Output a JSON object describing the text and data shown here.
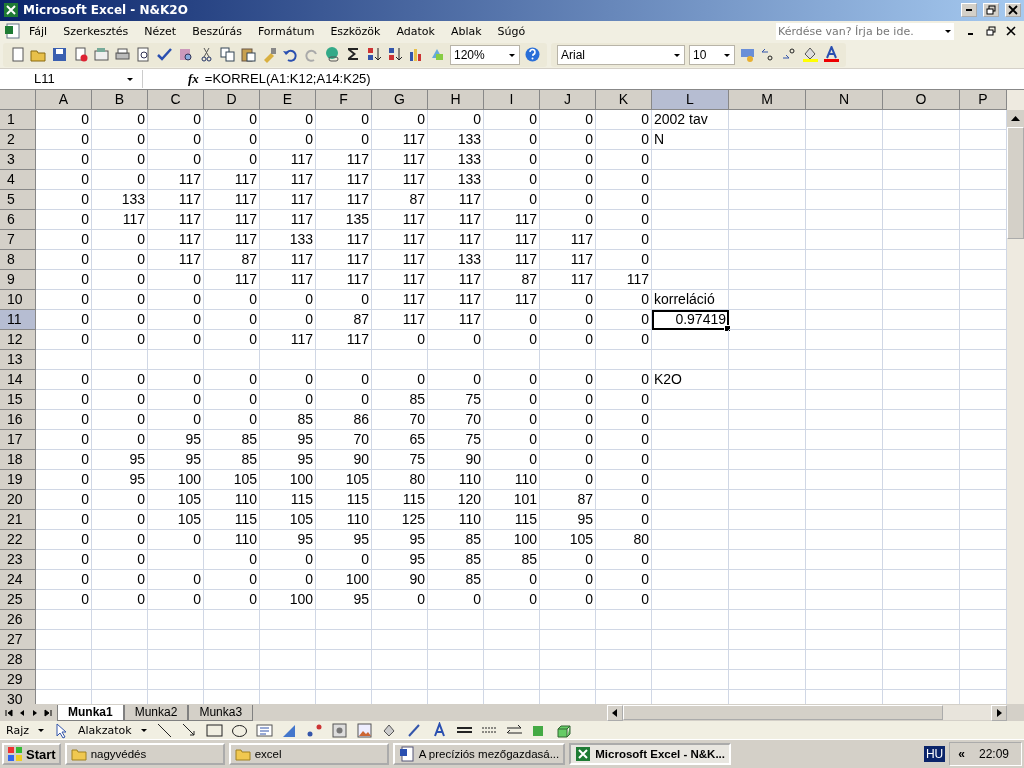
{
  "window": {
    "title": "Microsoft Excel - N&K2O"
  },
  "menu": {
    "items": [
      "Fájl",
      "Szerkesztés",
      "Nézet",
      "Beszúrás",
      "Formátum",
      "Eszközök",
      "Adatok",
      "Ablak",
      "Súgó"
    ],
    "help_box": {
      "placeholder": "Kérdése van? Írja be ide."
    }
  },
  "toolbar": {
    "zoom": "120%",
    "font": "Arial",
    "font_size": "10"
  },
  "formula_bar": {
    "name_box": "L11",
    "fx": "fx",
    "formula": "=KORREL(A1:K12;A14:K25)"
  },
  "columns": [
    {
      "label": "A",
      "selected": false
    },
    {
      "label": "B",
      "selected": false
    },
    {
      "label": "C",
      "selected": false
    },
    {
      "label": "D",
      "selected": false
    },
    {
      "label": "E",
      "selected": false
    },
    {
      "label": "F",
      "selected": false
    },
    {
      "label": "G",
      "selected": false
    },
    {
      "label": "H",
      "selected": false
    },
    {
      "label": "I",
      "selected": false
    },
    {
      "label": "J",
      "selected": false
    },
    {
      "label": "K",
      "selected": false
    },
    {
      "label": "L",
      "selected": true
    },
    {
      "label": "M",
      "selected": false
    },
    {
      "label": "N",
      "selected": false
    },
    {
      "label": "O",
      "selected": false
    },
    {
      "label": "P",
      "selected": false
    }
  ],
  "rows": [
    {
      "header": "1",
      "selected": false,
      "cells": [
        "0",
        "0",
        "0",
        "0",
        "0",
        "0",
        "0",
        "0",
        "0",
        "0",
        "0"
      ],
      "note": {
        "text": "2002 tav",
        "kind": "label"
      }
    },
    {
      "header": "2",
      "selected": false,
      "cells": [
        "0",
        "0",
        "0",
        "0",
        "0",
        "0",
        "117",
        "133",
        "0",
        "0",
        "0"
      ],
      "note": {
        "text": "N",
        "kind": "label"
      }
    },
    {
      "header": "3",
      "selected": false,
      "cells": [
        "0",
        "0",
        "0",
        "0",
        "117",
        "117",
        "117",
        "133",
        "0",
        "0",
        "0"
      ]
    },
    {
      "header": "4",
      "selected": false,
      "cells": [
        "0",
        "0",
        "117",
        "117",
        "117",
        "117",
        "117",
        "133",
        "0",
        "0",
        "0"
      ]
    },
    {
      "header": "5",
      "selected": false,
      "cells": [
        "0",
        "133",
        "117",
        "117",
        "117",
        "117",
        "87",
        "117",
        "0",
        "0",
        "0"
      ]
    },
    {
      "header": "6",
      "selected": false,
      "cells": [
        "0",
        "117",
        "117",
        "117",
        "117",
        "135",
        "117",
        "117",
        "117",
        "0",
        "0"
      ]
    },
    {
      "header": "7",
      "selected": false,
      "cells": [
        "0",
        "0",
        "117",
        "117",
        "133",
        "117",
        "117",
        "117",
        "117",
        "117",
        "0"
      ]
    },
    {
      "header": "8",
      "selected": false,
      "cells": [
        "0",
        "0",
        "117",
        "87",
        "117",
        "117",
        "117",
        "133",
        "117",
        "117",
        "0"
      ]
    },
    {
      "header": "9",
      "selected": false,
      "cells": [
        "0",
        "0",
        "0",
        "117",
        "117",
        "117",
        "117",
        "117",
        "87",
        "117",
        "117"
      ]
    },
    {
      "header": "10",
      "selected": false,
      "cells": [
        "0",
        "0",
        "0",
        "0",
        "0",
        "0",
        "117",
        "117",
        "117",
        "0",
        "0"
      ],
      "note": {
        "text": "korreláció",
        "kind": "label"
      }
    },
    {
      "header": "11",
      "selected": true,
      "cells": [
        "0",
        "0",
        "0",
        "0",
        "0",
        "87",
        "117",
        "117",
        "0",
        "0",
        "0"
      ],
      "note": {
        "text": "0.97419",
        "kind": "number"
      }
    },
    {
      "header": "12",
      "selected": false,
      "cells": [
        "0",
        "0",
        "0",
        "0",
        "117",
        "117",
        "0",
        "0",
        "0",
        "0",
        "0"
      ]
    },
    {
      "header": "13",
      "selected": false
    },
    {
      "header": "14",
      "selected": false,
      "cells": [
        "0",
        "0",
        "0",
        "0",
        "0",
        "0",
        "0",
        "0",
        "0",
        "0",
        "0"
      ],
      "note": {
        "text": "K2O",
        "kind": "label"
      }
    },
    {
      "header": "15",
      "selected": false,
      "cells": [
        "0",
        "0",
        "0",
        "0",
        "0",
        "0",
        "85",
        "75",
        "0",
        "0",
        "0"
      ]
    },
    {
      "header": "16",
      "selected": false,
      "cells": [
        "0",
        "0",
        "0",
        "0",
        "85",
        "86",
        "70",
        "70",
        "0",
        "0",
        "0"
      ]
    },
    {
      "header": "17",
      "selected": false,
      "cells": [
        "0",
        "0",
        "95",
        "85",
        "95",
        "70",
        "65",
        "75",
        "0",
        "0",
        "0"
      ]
    },
    {
      "header": "18",
      "selected": false,
      "cells": [
        "0",
        "95",
        "95",
        "85",
        "95",
        "90",
        "75",
        "90",
        "0",
        "0",
        "0"
      ]
    },
    {
      "header": "19",
      "selected": false,
      "cells": [
        "0",
        "95",
        "100",
        "105",
        "100",
        "105",
        "80",
        "110",
        "110",
        "0",
        "0"
      ]
    },
    {
      "header": "20",
      "selected": false,
      "cells": [
        "0",
        "0",
        "105",
        "110",
        "115",
        "115",
        "115",
        "120",
        "101",
        "87",
        "0"
      ]
    },
    {
      "header": "21",
      "selected": false,
      "cells": [
        "0",
        "0",
        "105",
        "115",
        "105",
        "110",
        "125",
        "110",
        "115",
        "95",
        "0"
      ]
    },
    {
      "header": "22",
      "selected": false,
      "cells": [
        "0",
        "0",
        "0",
        "110",
        "95",
        "95",
        "95",
        "85",
        "100",
        "105",
        "80"
      ]
    },
    {
      "header": "23",
      "selected": false,
      "cells": [
        "0",
        "0",
        null,
        "0",
        "0",
        "0",
        "95",
        "85",
        "85",
        "0",
        "0"
      ]
    },
    {
      "header": "24",
      "selected": false,
      "cells": [
        "0",
        "0",
        "0",
        "0",
        "0",
        "100",
        "90",
        "85",
        "0",
        "0",
        "0"
      ]
    },
    {
      "header": "25",
      "selected": false,
      "cells": [
        "0",
        "0",
        "0",
        "0",
        "100",
        "95",
        "0",
        "0",
        "0",
        "0",
        "0"
      ]
    },
    {
      "header": "26",
      "selected": false
    },
    {
      "header": "27",
      "selected": false
    },
    {
      "header": "28",
      "selected": false
    },
    {
      "header": "29",
      "selected": false
    },
    {
      "header": "30",
      "selected": false
    }
  ],
  "sheet_tabs": [
    {
      "label": "Munka1",
      "selected": true
    },
    {
      "label": "Munka2",
      "selected": false
    },
    {
      "label": "Munka3",
      "selected": false
    }
  ],
  "drawing_toolbar": {
    "draw": "Rajz",
    "shapes": "Alakzatok"
  },
  "taskbar": {
    "start": "Start",
    "items": [
      {
        "label": "nagyvédés",
        "kind": "folder",
        "selected": false
      },
      {
        "label": "excel",
        "kind": "folder",
        "selected": false
      },
      {
        "label": "A precíziós mezőgazdasá...",
        "kind": "document",
        "selected": false
      },
      {
        "label": "Microsoft Excel - N&K...",
        "kind": "sheet",
        "selected": true
      }
    ],
    "language": "HU",
    "expand": "«",
    "clock": "22:09"
  }
}
